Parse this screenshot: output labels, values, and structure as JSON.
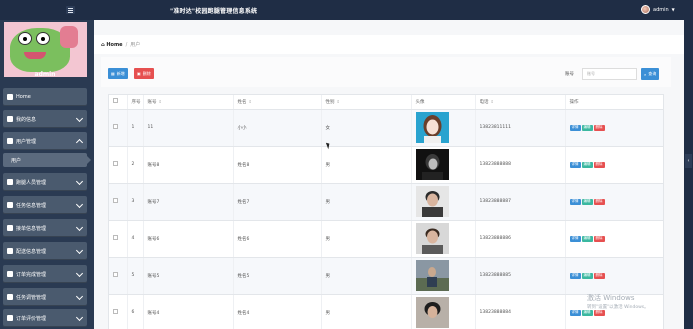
{
  "header": {
    "title": "\"准时达\"校园跑腿管理信息系统",
    "user_name": "admin"
  },
  "sidebar": {
    "avatar_name": "admin",
    "items": [
      {
        "label": "Home",
        "open": false
      },
      {
        "label": "我的信息",
        "open": false
      },
      {
        "label": "用户管理",
        "open": true
      },
      {
        "label": "跑腿人员管理",
        "open": false
      },
      {
        "label": "任务信息管理",
        "open": false
      },
      {
        "label": "接单信息管理",
        "open": false
      },
      {
        "label": "配送信息管理",
        "open": false
      },
      {
        "label": "订单完成管理",
        "open": false
      },
      {
        "label": "任务调管管理",
        "open": false
      },
      {
        "label": "订单评价管理",
        "open": false
      }
    ],
    "sub_items": [
      {
        "label": "用户"
      }
    ]
  },
  "breadcrumb": {
    "home": "Home",
    "separator": "/",
    "current": "用户"
  },
  "toolbar": {
    "add_label": "新增",
    "delete_label": "删除",
    "search_label": "账号",
    "search_placeholder": "账号",
    "search_button": "查询"
  },
  "table": {
    "columns": [
      "序号",
      "账号",
      "姓名",
      "性别",
      "头像",
      "电话",
      "操作"
    ],
    "rows": [
      {
        "index": "1",
        "account": "11",
        "name": "小小",
        "gender": "女",
        "phone": "13823811111"
      },
      {
        "index": "2",
        "account": "账号8",
        "name": "姓名8",
        "gender": "男",
        "phone": "13823888888"
      },
      {
        "index": "3",
        "account": "账号7",
        "name": "姓名7",
        "gender": "男",
        "phone": "13823888887"
      },
      {
        "index": "4",
        "account": "账号6",
        "name": "姓名6",
        "gender": "男",
        "phone": "13823888886"
      },
      {
        "index": "5",
        "account": "账号5",
        "name": "姓名5",
        "gender": "男",
        "phone": "13823888885"
      },
      {
        "index": "6",
        "account": "账号4",
        "name": "姓名4",
        "gender": "男",
        "phone": "13823888884"
      }
    ],
    "ops": {
      "view": "详情",
      "edit": "编辑",
      "delete": "删除"
    }
  },
  "watermark": {
    "line1": "激活 Windows",
    "line2": "转到\"设置\"以激活 Windows。"
  },
  "colors": {
    "topbar": "#1f2d45",
    "sidebar": "#2a3a52",
    "accent_blue": "#3b8fd6",
    "danger_red": "#e65050"
  }
}
